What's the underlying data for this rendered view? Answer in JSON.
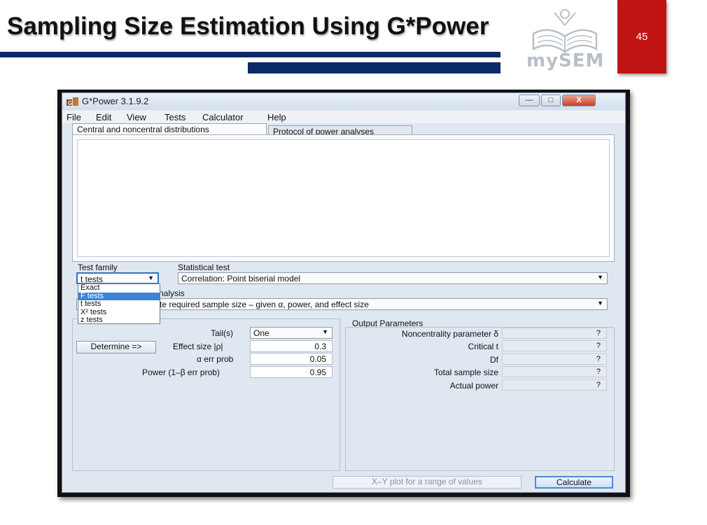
{
  "slide": {
    "title": "Sampling Size Estimation Using G*Power",
    "page_number": "45",
    "logo_text": "mySEM",
    "colors": {
      "bars": "#0b2a66",
      "page_box": "#c01414"
    }
  },
  "window": {
    "title": "G*Power 3.1.9.2",
    "app_icon": "gpower-icon",
    "controls": {
      "minimize": "—",
      "maximize": "□",
      "close": "X"
    }
  },
  "menu": [
    "File",
    "Edit",
    "View",
    "Tests",
    "Calculator",
    "Help"
  ],
  "tabs": [
    {
      "label": "Central and noncentral distributions",
      "active": true
    },
    {
      "label": "Protocol of power analyses",
      "active": false
    }
  ],
  "test_family": {
    "label": "Test family",
    "selected": "t tests",
    "options": [
      "Exact",
      "F tests",
      "t tests",
      "X² tests",
      "z tests"
    ],
    "highlighted": "F tests"
  },
  "statistical_test": {
    "label": "Statistical test",
    "selected": "Correlation: Point biserial model"
  },
  "analysis": {
    "label_visible": "nalysis",
    "selected_visible": "te required sample size – given α, power, and effect size"
  },
  "input": {
    "determine_label": "Determine =>",
    "tails_label": "Tail(s)",
    "tails_value": "One",
    "effect_label": "Effect size |ρ|",
    "effect_value": "0.3",
    "alpha_label": "α err prob",
    "alpha_value": "0.05",
    "power_label": "Power (1–β err prob)",
    "power_value": "0.95"
  },
  "output": {
    "label": "Output Parameters",
    "rows": [
      {
        "label": "Noncentrality parameter δ",
        "value": "?"
      },
      {
        "label": "Critical t",
        "value": "?"
      },
      {
        "label": "Df",
        "value": "?"
      },
      {
        "label": "Total sample size",
        "value": "?"
      },
      {
        "label": "Actual power",
        "value": "?"
      }
    ]
  },
  "buttons": {
    "xy_plot": "X–Y plot for a range of values",
    "calculate": "Calculate"
  }
}
